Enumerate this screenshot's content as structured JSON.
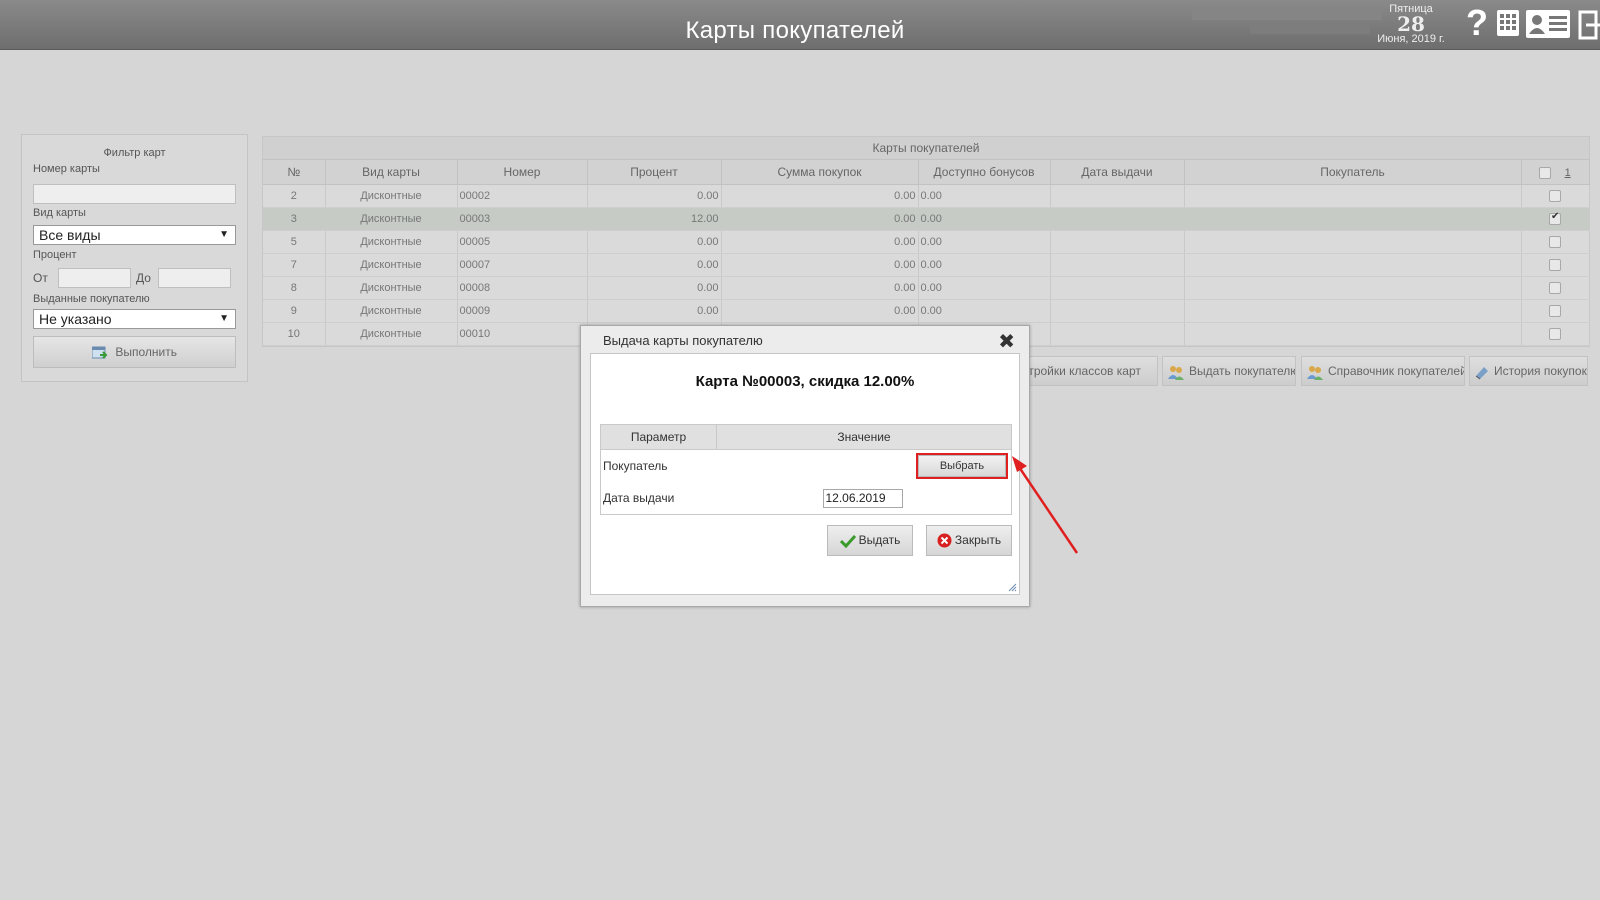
{
  "header": {
    "title": "Карты покупателей",
    "date": {
      "weekday": "Пятница",
      "day": "28",
      "month_year": "Июня, 2019 г."
    },
    "icons": [
      "help-icon",
      "grid-icon",
      "customer-card-icon",
      "exit-icon"
    ]
  },
  "filter": {
    "title": "Фильтр карт",
    "card_number_label": "Номер карты",
    "card_number_value": "",
    "card_type_label": "Вид карты",
    "card_type_value": "Все виды",
    "percent_label": "Процент",
    "from_label": "От",
    "to_label": "До",
    "issued_label": "Выданные покупателю",
    "issued_value": "Не указано",
    "run_button": "Выполнить"
  },
  "table": {
    "caption": "Карты покупателей",
    "columns": [
      "№",
      "Вид карты",
      "Номер",
      "Процент",
      "Сумма покупок",
      "Доступно бонусов",
      "Дата выдачи",
      "Покупатель"
    ],
    "header_count": "1",
    "rows": [
      {
        "n": "2",
        "type": "Дисконтные",
        "number": "00002",
        "percent": "0.00",
        "sum": "0.00",
        "bonus": "0.00",
        "date": "",
        "customer": "",
        "checked": false
      },
      {
        "n": "3",
        "type": "Дисконтные",
        "number": "00003",
        "percent": "12.00",
        "sum": "0.00",
        "bonus": "0.00",
        "date": "",
        "customer": "",
        "checked": true
      },
      {
        "n": "5",
        "type": "Дисконтные",
        "number": "00005",
        "percent": "0.00",
        "sum": "0.00",
        "bonus": "0.00",
        "date": "",
        "customer": "",
        "checked": false
      },
      {
        "n": "7",
        "type": "Дисконтные",
        "number": "00007",
        "percent": "0.00",
        "sum": "0.00",
        "bonus": "0.00",
        "date": "",
        "customer": "",
        "checked": false
      },
      {
        "n": "8",
        "type": "Дисконтные",
        "number": "00008",
        "percent": "0.00",
        "sum": "0.00",
        "bonus": "0.00",
        "date": "",
        "customer": "",
        "checked": false
      },
      {
        "n": "9",
        "type": "Дисконтные",
        "number": "00009",
        "percent": "0.00",
        "sum": "0.00",
        "bonus": "0.00",
        "date": "",
        "customer": "",
        "checked": false
      },
      {
        "n": "10",
        "type": "Дисконтные",
        "number": "00010",
        "percent": "",
        "sum": "",
        "bonus": "",
        "date": "",
        "customer": "",
        "checked": false
      }
    ]
  },
  "actions": {
    "card_classes": "Настройки классов карт",
    "issue_to_customer": "Выдать покупателю",
    "customer_directory": "Справочник покупателей",
    "purchase_history": "История покупок"
  },
  "modal": {
    "title": "Выдача карты покупателю",
    "heading": "Карта №00003, скидка 12.00%",
    "param_col": "Параметр",
    "value_col": "Значение",
    "customer_label": "Покупатель",
    "choose_button": "Выбрать",
    "date_label": "Дата выдачи",
    "date_value": "12.06.2019",
    "issue_button": "Выдать",
    "close_button": "Закрыть"
  },
  "colors": {
    "highlight": "#e02020",
    "header_bg": "#7a7a7a",
    "selected_row": "#c6cbc6"
  }
}
